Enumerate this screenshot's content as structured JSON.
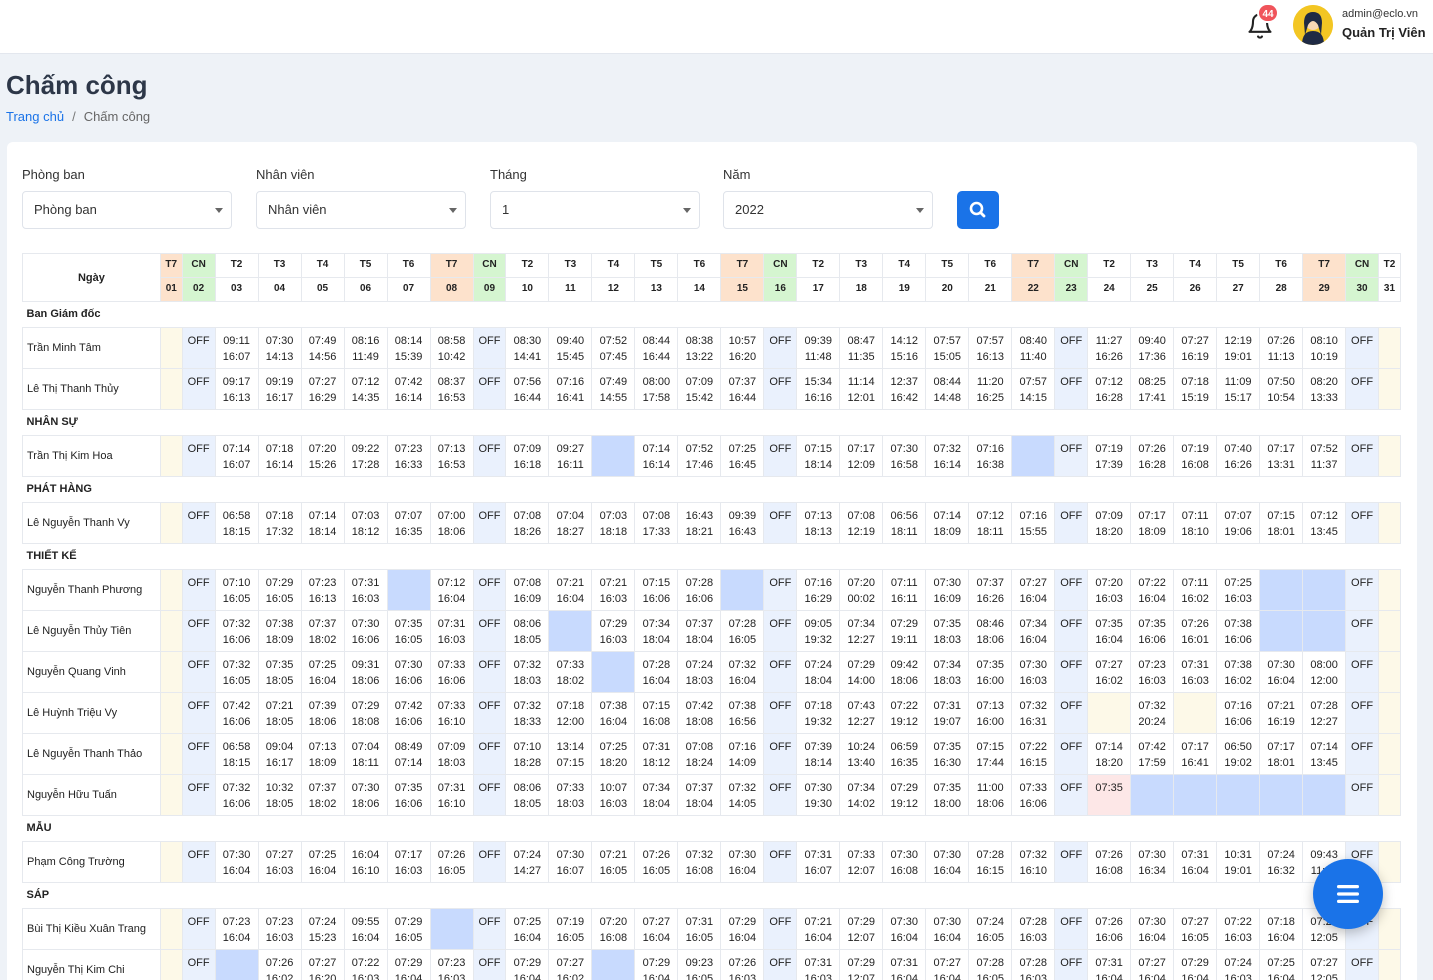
{
  "header": {
    "notification_count": "44",
    "user_email": "admin@eclo.vn",
    "user_name": "Quản Trị Viên"
  },
  "page": {
    "title": "Chấm công",
    "breadcrumb_home": "Trang chủ",
    "breadcrumb_sep": "/",
    "breadcrumb_current": "Chấm công"
  },
  "filters": {
    "department_label": "Phòng ban",
    "department_value": "Phòng ban",
    "employee_label": "Nhân viên",
    "employee_value": "Nhân viên",
    "month_label": "Tháng",
    "month_value": "1",
    "year_label": "Năm",
    "year_value": "2022"
  },
  "table": {
    "day_header": "Ngày",
    "days": [
      {
        "w": "T7",
        "d": "01",
        "t": "sat"
      },
      {
        "w": "CN",
        "d": "02",
        "t": "sun"
      },
      {
        "w": "T2",
        "d": "03",
        "t": "wk"
      },
      {
        "w": "T3",
        "d": "04",
        "t": "wk"
      },
      {
        "w": "T4",
        "d": "05",
        "t": "wk"
      },
      {
        "w": "T5",
        "d": "06",
        "t": "wk"
      },
      {
        "w": "T6",
        "d": "07",
        "t": "wk"
      },
      {
        "w": "T7",
        "d": "08",
        "t": "sat"
      },
      {
        "w": "CN",
        "d": "09",
        "t": "sun"
      },
      {
        "w": "T2",
        "d": "10",
        "t": "wk"
      },
      {
        "w": "T3",
        "d": "11",
        "t": "wk"
      },
      {
        "w": "T4",
        "d": "12",
        "t": "wk"
      },
      {
        "w": "T5",
        "d": "13",
        "t": "wk"
      },
      {
        "w": "T6",
        "d": "14",
        "t": "wk"
      },
      {
        "w": "T7",
        "d": "15",
        "t": "sat"
      },
      {
        "w": "CN",
        "d": "16",
        "t": "sun"
      },
      {
        "w": "T2",
        "d": "17",
        "t": "wk"
      },
      {
        "w": "T3",
        "d": "18",
        "t": "wk"
      },
      {
        "w": "T4",
        "d": "19",
        "t": "wk"
      },
      {
        "w": "T5",
        "d": "20",
        "t": "wk"
      },
      {
        "w": "T6",
        "d": "21",
        "t": "wk"
      },
      {
        "w": "T7",
        "d": "22",
        "t": "sat"
      },
      {
        "w": "CN",
        "d": "23",
        "t": "sun"
      },
      {
        "w": "T2",
        "d": "24",
        "t": "wk"
      },
      {
        "w": "T3",
        "d": "25",
        "t": "wk"
      },
      {
        "w": "T4",
        "d": "26",
        "t": "wk"
      },
      {
        "w": "T5",
        "d": "27",
        "t": "wk"
      },
      {
        "w": "T6",
        "d": "28",
        "t": "wk"
      },
      {
        "w": "T7",
        "d": "29",
        "t": "sat"
      },
      {
        "w": "CN",
        "d": "30",
        "t": "sun"
      },
      {
        "w": "T2",
        "d": "31",
        "t": "wk"
      }
    ],
    "groups": [
      {
        "dept": "Ban Giám đốc",
        "rows": [
          {
            "name": "Trần Minh Tâm",
            "cells": [
              "F",
              "OFF",
              "09:11|16:07",
              "07:30|14:13",
              "07:49|14:56",
              "08:16|11:49",
              "08:14|15:39",
              "08:58|10:42",
              "OFF",
              "08:30|14:41",
              "09:40|15:45",
              "07:52|07:45",
              "08:44|16:44",
              "08:38|13:22",
              "10:57|16:20",
              "OFF",
              "09:39|11:48",
              "08:47|11:35",
              "14:12|15:16",
              "07:57|15:05",
              "07:57|16:13",
              "08:40|11:40",
              "OFF",
              "11:27|16:26",
              "09:40|17:36",
              "07:27|16:19",
              "12:19|19:01",
              "07:26|11:13",
              "08:10|10:19",
              "OFF",
              "F"
            ]
          },
          {
            "name": "Lê Thị Thanh Thủy",
            "cells": [
              "F",
              "OFF",
              "09:17|16:13",
              "09:19|16:17",
              "07:27|16:29",
              "07:12|14:35",
              "07:42|16:14",
              "08:37|16:53",
              "OFF",
              "07:56|16:44",
              "07:16|16:41",
              "07:49|14:55",
              "08:00|17:58",
              "07:09|15:42",
              "07:37|16:44",
              "OFF",
              "15:34|16:16",
              "11:14|12:01",
              "12:37|16:42",
              "08:44|14:48",
              "11:20|16:25",
              "07:57|14:15",
              "OFF",
              "07:12|16:28",
              "08:25|17:41",
              "07:18|15:19",
              "11:09|15:17",
              "07:50|10:54",
              "08:20|13:33",
              "OFF",
              "F"
            ]
          }
        ]
      },
      {
        "dept": "NHÂN SỰ",
        "rows": [
          {
            "name": "Trần Thị Kim Hoa",
            "cells": [
              "F",
              "OFF",
              "07:14|16:07",
              "07:18|16:14",
              "07:20|15:26",
              "09:22|17:28",
              "07:23|16:33",
              "07:13|16:53",
              "OFF",
              "07:09|16:18",
              "09:27|16:11",
              "B",
              "07:14|16:14",
              "07:52|17:46",
              "07:25|16:45",
              "OFF",
              "07:15|18:14",
              "07:17|12:09",
              "07:30|16:58",
              "07:32|16:14",
              "07:16|16:38",
              "B",
              "OFF",
              "07:19|17:39",
              "07:26|16:28",
              "07:19|16:08",
              "07:40|16:26",
              "07:17|13:31",
              "07:52|11:37",
              "OFF",
              "F"
            ]
          }
        ]
      },
      {
        "dept": "PHÁT HÀNG",
        "rows": [
          {
            "name": "Lê Nguyễn Thanh Vy",
            "cells": [
              "F",
              "OFF",
              "06:58|18:15",
              "07:18|17:32",
              "07:14|18:14",
              "07:03|18:12",
              "07:07|16:35",
              "07:00|18:06",
              "OFF",
              "07:08|18:26",
              "07:04|18:27",
              "07:03|18:18",
              "07:08|17:33",
              "16:43|18:21",
              "09:39|16:43",
              "OFF",
              "07:13|18:13",
              "07:08|12:19",
              "06:56|18:11",
              "07:14|18:09",
              "07:12|18:11",
              "07:16|15:55",
              "OFF",
              "07:09|18:20",
              "07:17|18:09",
              "07:11|18:10",
              "07:07|19:06",
              "07:15|18:01",
              "07:12|13:45",
              "OFF",
              "F"
            ]
          }
        ]
      },
      {
        "dept": "THIẾT KẾ",
        "rows": [
          {
            "name": "Nguyễn Thanh Phương",
            "cells": [
              "F",
              "OFF",
              "07:10|16:05",
              "07:29|16:05",
              "07:23|16:13",
              "07:31|16:03",
              "B",
              "07:12|16:04",
              "OFF",
              "07:08|16:09",
              "07:21|16:04",
              "07:21|16:03",
              "07:15|16:06",
              "07:28|16:06",
              "B",
              "OFF",
              "07:16|16:29",
              "07:20|00:02",
              "07:11|16:11",
              "07:30|16:09",
              "07:37|16:26",
              "07:27|16:04",
              "OFF",
              "07:20|16:03",
              "07:22|16:04",
              "07:11|16:02",
              "07:25|16:03",
              "B",
              "B",
              "OFF",
              "F"
            ]
          },
          {
            "name": "Lê Nguyễn Thủy Tiên",
            "cells": [
              "F",
              "OFF",
              "07:32|16:06",
              "07:38|18:09",
              "07:37|18:02",
              "07:30|16:06",
              "07:35|16:05",
              "07:31|16:03",
              "OFF",
              "08:06|18:05",
              "B",
              "07:29|16:03",
              "07:34|18:04",
              "07:37|18:04",
              "07:28|16:05",
              "OFF",
              "09:05|19:32",
              "07:34|12:27",
              "07:29|19:11",
              "07:35|18:03",
              "08:46|18:06",
              "07:34|16:04",
              "OFF",
              "07:35|16:04",
              "07:35|16:06",
              "07:26|16:01",
              "07:38|16:06",
              "B",
              "B",
              "OFF",
              "F"
            ]
          },
          {
            "name": "Nguyễn Quang Vinh",
            "cells": [
              "F",
              "OFF",
              "07:32|16:05",
              "07:35|18:05",
              "07:25|16:04",
              "09:31|18:06",
              "07:30|16:06",
              "07:33|16:06",
              "OFF",
              "07:32|18:03",
              "07:33|18:02",
              "B",
              "07:28|16:04",
              "07:24|18:03",
              "07:32|16:04",
              "OFF",
              "07:24|18:04",
              "07:29|14:00",
              "09:42|18:06",
              "07:34|18:03",
              "07:35|16:00",
              "07:30|16:03",
              "OFF",
              "07:27|16:02",
              "07:23|16:03",
              "07:31|16:03",
              "07:38|16:02",
              "07:30|16:04",
              "08:00|12:00",
              "OFF",
              "F"
            ]
          },
          {
            "name": "Lê Huỳnh Triệu Vy",
            "cells": [
              "F",
              "OFF",
              "07:42|16:06",
              "07:21|18:05",
              "07:39|18:06",
              "07:29|18:08",
              "07:42|16:06",
              "07:33|16:10",
              "OFF",
              "07:32|18:33",
              "07:18|12:00",
              "07:38|16:04",
              "07:15|16:08",
              "07:42|18:08",
              "07:38|16:56",
              "OFF",
              "07:18|19:32",
              "07:43|12:27",
              "07:22|19:12",
              "07:31|19:07",
              "07:13|16:00",
              "07:32|16:31",
              "OFF",
              "Y",
              "07:32|20:24",
              "Y",
              "07:16|16:06",
              "07:21|16:19",
              "07:28|12:27",
              "OFF",
              "F"
            ]
          },
          {
            "name": "Lê Nguyễn Thanh Thảo",
            "cells": [
              "F",
              "OFF",
              "06:58|18:15",
              "09:04|16:17",
              "07:13|18:09",
              "07:04|18:11",
              "08:49|07:14",
              "07:09|18:03",
              "OFF",
              "07:10|18:28",
              "13:14|07:15",
              "07:25|18:20",
              "07:31|18:12",
              "07:08|18:24",
              "07:16|14:09",
              "OFF",
              "07:39|18:14",
              "10:24|13:40",
              "06:59|16:35",
              "07:35|16:30",
              "07:15|17:44",
              "07:22|16:15",
              "OFF",
              "07:14|18:20",
              "07:42|17:59",
              "07:17|16:41",
              "06:50|19:02",
              "07:17|18:01",
              "07:14|13:45",
              "OFF",
              "F"
            ]
          },
          {
            "name": "Nguyễn Hữu Tuấn",
            "cells": [
              "F",
              "OFF",
              "07:32|16:06",
              "10:32|18:05",
              "07:37|18:02",
              "07:30|18:06",
              "07:35|16:06",
              "07:31|16:10",
              "OFF",
              "08:06|18:05",
              "07:33|18:03",
              "10:07|16:03",
              "07:34|18:04",
              "07:37|18:04",
              "07:32|14:05",
              "OFF",
              "07:30|19:30",
              "07:34|14:02",
              "07:29|19:12",
              "07:35|18:00",
              "11:00|18:06",
              "07:33|16:06",
              "OFF",
              "R07:35",
              "B",
              "B",
              "B",
              "B",
              "B",
              "OFF",
              "F"
            ]
          }
        ]
      },
      {
        "dept": "MẪU",
        "rows": [
          {
            "name": "Phạm Công Trường",
            "cells": [
              "F",
              "OFF",
              "07:30|16:04",
              "07:27|16:03",
              "07:25|16:04",
              "16:04|16:10",
              "07:17|16:03",
              "07:26|16:05",
              "OFF",
              "07:24|14:27",
              "07:30|16:07",
              "07:21|16:05",
              "07:26|16:05",
              "07:32|16:08",
              "07:30|16:04",
              "OFF",
              "07:31|16:07",
              "07:33|12:07",
              "07:30|16:08",
              "07:30|16:04",
              "07:28|16:15",
              "07:32|16:10",
              "OFF",
              "07:26|16:08",
              "07:30|16:34",
              "07:31|16:04",
              "10:31|19:01",
              "07:24|16:32",
              "09:43|11:50",
              "OFF",
              "F"
            ]
          }
        ]
      },
      {
        "dept": "SÁP",
        "rows": [
          {
            "name": "Bùi Thị Kiều Xuân Trang",
            "cells": [
              "F",
              "OFF",
              "07:23|16:04",
              "07:23|16:03",
              "07:24|15:23",
              "09:55|16:04",
              "07:29|16:05",
              "B",
              "OFF",
              "07:25|16:04",
              "07:19|16:05",
              "07:20|16:08",
              "07:27|16:04",
              "07:31|16:05",
              "07:29|16:04",
              "OFF",
              "07:21|16:04",
              "07:29|12:07",
              "07:30|16:04",
              "07:30|16:04",
              "07:24|16:05",
              "07:28|16:03",
              "OFF",
              "07:26|16:06",
              "07:30|16:04",
              "07:27|16:05",
              "07:22|16:03",
              "07:18|16:04",
              "07:27|12:05",
              "OFF",
              "F"
            ]
          },
          {
            "name": "Nguyễn Thị Kim Chi",
            "cells": [
              "F",
              "OFF",
              "B",
              "07:26|16:02",
              "07:27|16:20",
              "07:22|16:03",
              "07:29|16:04",
              "07:23|16:03",
              "OFF",
              "07:29|16:04",
              "07:27|16:02",
              "B",
              "07:29|16:04",
              "09:23|16:05",
              "07:26|16:03",
              "OFF",
              "07:31|16:03",
              "07:29|12:07",
              "07:31|16:04",
              "07:27|16:04",
              "07:28|16:05",
              "07:28|16:03",
              "OFF",
              "07:31|16:04",
              "07:27|16:04",
              "07:29|16:04",
              "07:24|16:03",
              "07:25|16:04",
              "07:27|12:05",
              "OFF",
              "F"
            ]
          }
        ]
      }
    ]
  },
  "icons": {
    "bell": "bell-icon",
    "search": "search-icon",
    "menu": "hamburger-menu-icon"
  },
  "colors": {
    "accent": "#1a73e8",
    "saturday": "#fde2cc",
    "sunday": "#d5f5d0",
    "off_cell": "#eaf1fd",
    "absent_cell": "#c8dafe",
    "badge": "#f0545b"
  }
}
